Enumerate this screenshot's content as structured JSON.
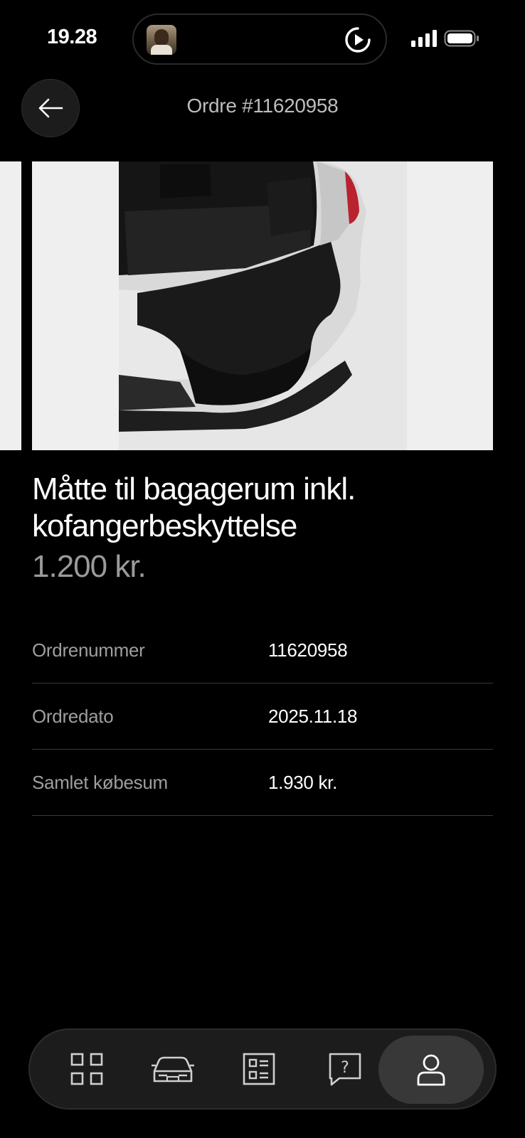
{
  "status_bar": {
    "time": "19.28"
  },
  "header": {
    "title": "Ordre #11620958"
  },
  "product": {
    "name": "Måtte til bagagerum inkl. kofangerbeskyttelse",
    "price": "1.200 kr."
  },
  "details": [
    {
      "label": "Ordrenummer",
      "value": "11620958"
    },
    {
      "label": "Ordredato",
      "value": "2025.11.18"
    },
    {
      "label": "Samlet købesum",
      "value": "1.930 kr."
    }
  ],
  "bottom_nav": {
    "items": [
      {
        "icon": "grid-icon",
        "active": false
      },
      {
        "icon": "car-icon",
        "active": false
      },
      {
        "icon": "document-list-icon",
        "active": false
      },
      {
        "icon": "help-icon",
        "active": false
      },
      {
        "icon": "profile-icon",
        "active": true
      }
    ]
  },
  "colors": {
    "background": "#000000",
    "text_primary": "#ffffff",
    "text_secondary": "#9e9e9e",
    "divider": "#3a3a3a",
    "nav_background": "#1c1c1c",
    "nav_active": "#383838"
  }
}
